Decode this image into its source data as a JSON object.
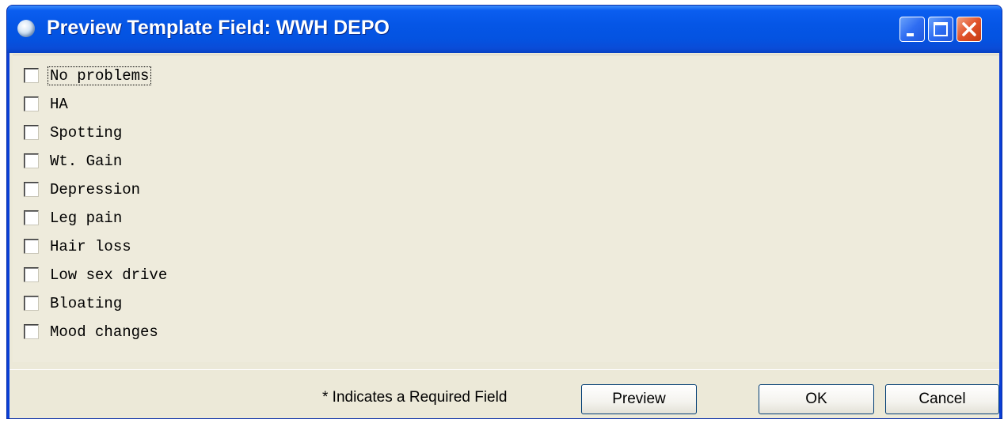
{
  "window": {
    "title": "Preview Template Field: WWH DEPO"
  },
  "checklist": {
    "items": [
      {
        "label": "No problems",
        "checked": false
      },
      {
        "label": "HA",
        "checked": false
      },
      {
        "label": "Spotting",
        "checked": false
      },
      {
        "label": "Wt. Gain",
        "checked": false
      },
      {
        "label": "Depression",
        "checked": false
      },
      {
        "label": "Leg pain",
        "checked": false
      },
      {
        "label": "Hair loss",
        "checked": false
      },
      {
        "label": "Low sex drive",
        "checked": false
      },
      {
        "label": "Bloating",
        "checked": false
      },
      {
        "label": "Mood changes",
        "checked": false
      }
    ]
  },
  "footer": {
    "required_note": "* Indicates a Required Field",
    "preview_label": "Preview",
    "ok_label": "OK",
    "cancel_label": "Cancel"
  },
  "colors": {
    "titlebar": "#0556e6",
    "client_background": "#ece9d8",
    "close_button": "#e1522a"
  }
}
